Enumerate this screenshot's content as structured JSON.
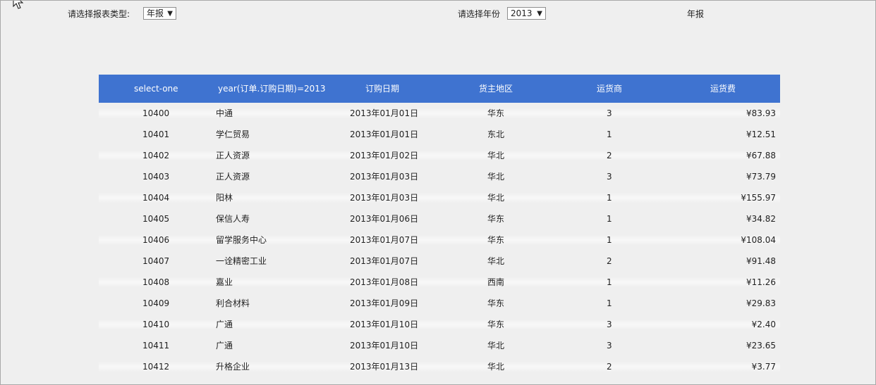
{
  "filters": {
    "report_type_label": "请选择报表类型:",
    "report_type_value": "年报",
    "year_label": "请选择年份",
    "year_value": "2013",
    "mode_text": "年报"
  },
  "table": {
    "headers": [
      "select-one",
      "year(订单.订购日期)=2013",
      "订购日期",
      "货主地区",
      "运货商",
      "运货费"
    ],
    "rows": [
      [
        "10400",
        "中通",
        "2013年01月01日",
        "华东",
        "3",
        "¥83.93"
      ],
      [
        "10401",
        "学仁贸易",
        "2013年01月01日",
        "东北",
        "1",
        "¥12.51"
      ],
      [
        "10402",
        "正人资源",
        "2013年01月02日",
        "华北",
        "2",
        "¥67.88"
      ],
      [
        "10403",
        "正人资源",
        "2013年01月03日",
        "华北",
        "3",
        "¥73.79"
      ],
      [
        "10404",
        "阳林",
        "2013年01月03日",
        "华北",
        "1",
        "¥155.97"
      ],
      [
        "10405",
        "保信人寿",
        "2013年01月06日",
        "华东",
        "1",
        "¥34.82"
      ],
      [
        "10406",
        "留学服务中心",
        "2013年01月07日",
        "华东",
        "1",
        "¥108.04"
      ],
      [
        "10407",
        "一诠精密工业",
        "2013年01月07日",
        "华北",
        "2",
        "¥91.48"
      ],
      [
        "10408",
        "嘉业",
        "2013年01月08日",
        "西南",
        "1",
        "¥11.26"
      ],
      [
        "10409",
        "利合材料",
        "2013年01月09日",
        "华东",
        "1",
        "¥29.83"
      ],
      [
        "10410",
        "广通",
        "2013年01月10日",
        "华东",
        "3",
        "¥2.40"
      ],
      [
        "10411",
        "广通",
        "2013年01月10日",
        "华北",
        "3",
        "¥23.65"
      ],
      [
        "10412",
        "升格企业",
        "2013年01月13日",
        "华北",
        "2",
        "¥3.77"
      ]
    ]
  },
  "icons": {
    "cursor": "arrow-cursor-icon",
    "select_arrow": "dropdown-arrow-icon"
  },
  "colors": {
    "header_bg": "#3f73d0",
    "header_text": "#ffffff",
    "page_bg": "#efefef"
  }
}
